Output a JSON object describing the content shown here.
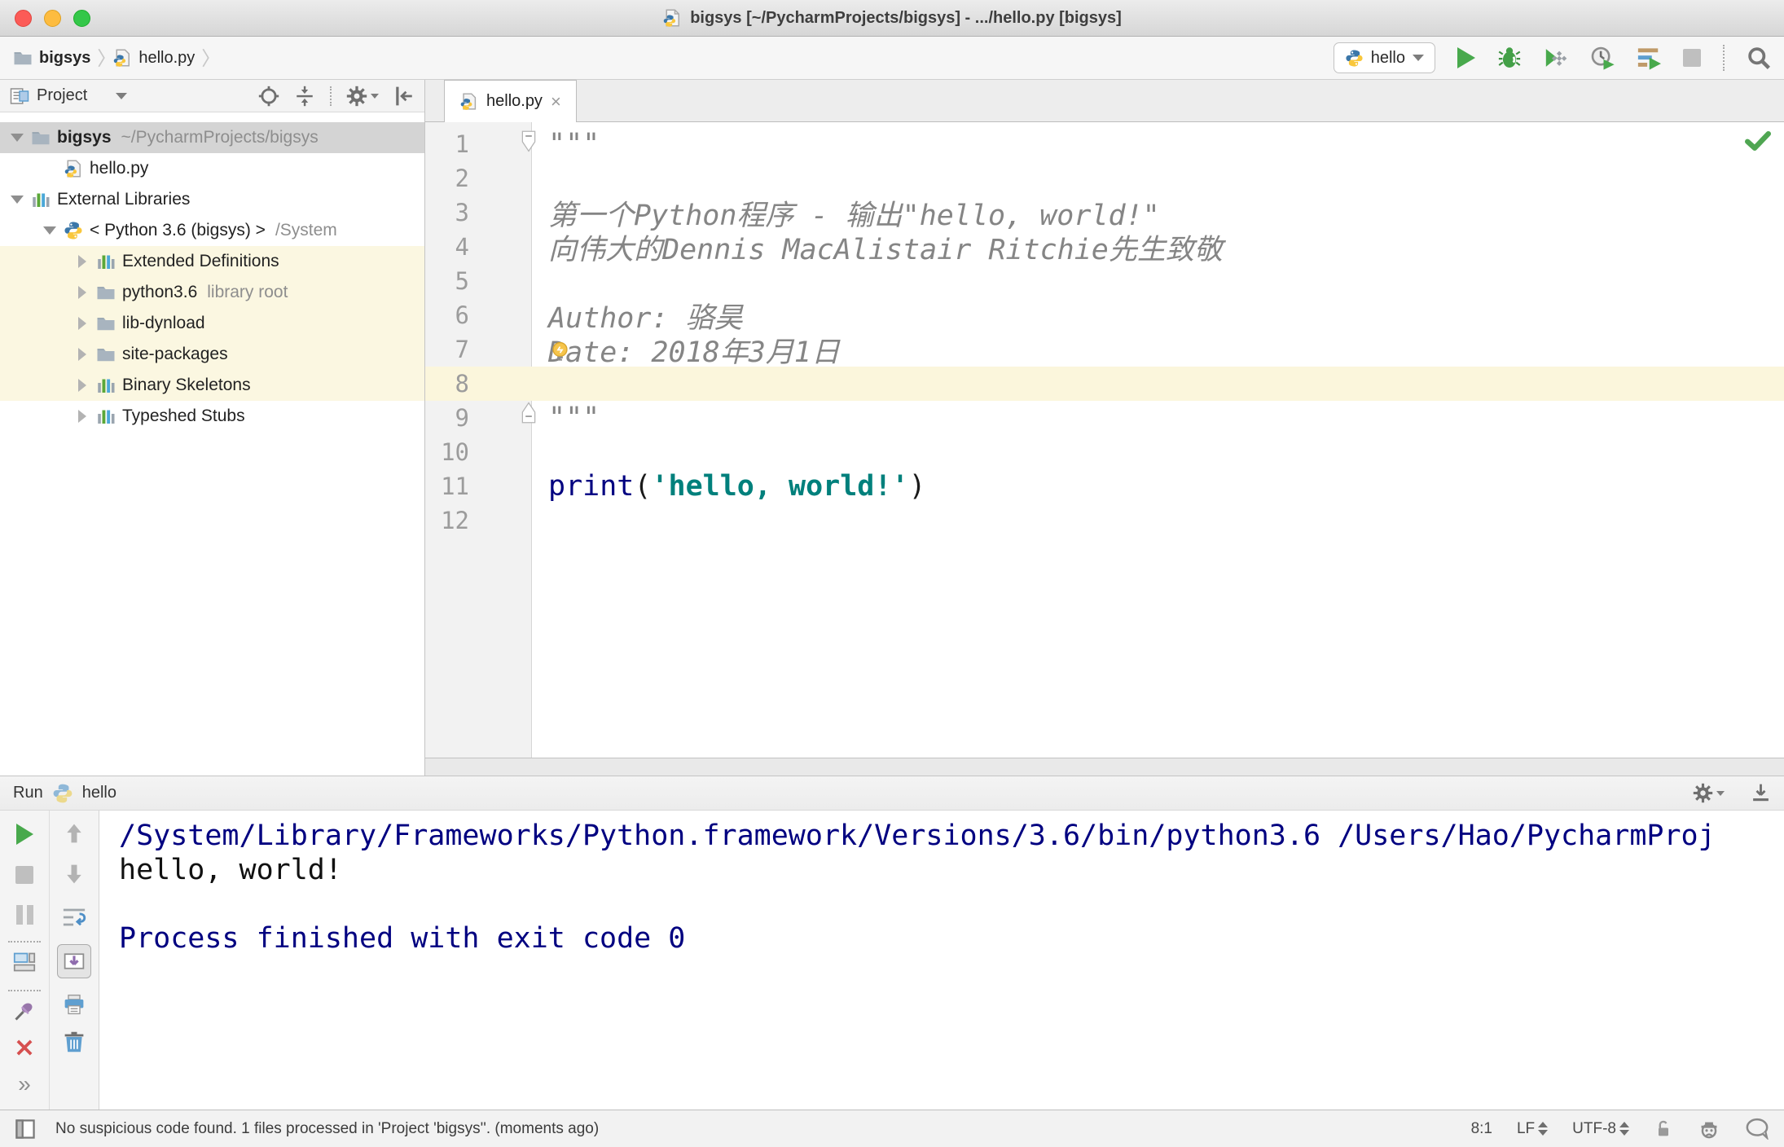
{
  "window": {
    "title": "bigsys [~/PycharmProjects/bigsys] - .../hello.py [bigsys]"
  },
  "navbar": {
    "breadcrumbs": [
      {
        "label": "bigsys"
      },
      {
        "label": "hello.py"
      }
    ],
    "run_config": "hello",
    "tools": {
      "run": "Run",
      "debug": "Debug",
      "coverage": "Run with Coverage",
      "profile": "Profile",
      "concurrency": "Concurrency Diagram",
      "stop": "Stop",
      "search": "Search Everywhere"
    }
  },
  "project": {
    "title": "Project",
    "tree": [
      {
        "label": "bigsys",
        "suffix": "~/PycharmProjects/bigsys"
      },
      {
        "label": "hello.py"
      },
      {
        "label": "External Libraries"
      },
      {
        "label": "< Python 3.6 (bigsys) >",
        "suffix": "/System"
      },
      {
        "label": "Extended Definitions"
      },
      {
        "label": "python3.6",
        "suffix": "library root"
      },
      {
        "label": "lib-dynload"
      },
      {
        "label": "site-packages"
      },
      {
        "label": "Binary Skeletons"
      },
      {
        "label": "Typeshed Stubs"
      }
    ]
  },
  "editor": {
    "tab": "hello.py",
    "lines": [
      {
        "num": "1",
        "text": "\"\"\""
      },
      {
        "num": "2",
        "text": ""
      },
      {
        "num": "3",
        "text": "第一个Python程序 - 输出\"hello, world!\""
      },
      {
        "num": "4",
        "text": "向伟大的Dennis MacAlistair Ritchie先生致敬"
      },
      {
        "num": "5",
        "text": ""
      },
      {
        "num": "6",
        "text": "Author: 骆昊"
      },
      {
        "num": "7",
        "text": "Date: 2018年3月1日"
      },
      {
        "num": "8",
        "text": ""
      },
      {
        "num": "9",
        "text": "\"\"\""
      },
      {
        "num": "10",
        "text": ""
      },
      {
        "num": "11",
        "kw": "print",
        "open": "(",
        "str": "'hello, world!'",
        "close": ")"
      },
      {
        "num": "12",
        "text": ""
      }
    ]
  },
  "run_panel": {
    "label": "Run",
    "config": "hello",
    "console": [
      "/System/Library/Frameworks/Python.framework/Versions/3.6/bin/python3.6 /Users/Hao/PycharmProj",
      "hello, world!",
      "",
      "Process finished with exit code 0"
    ]
  },
  "statusbar": {
    "message": "No suspicious code found. 1 files processed in 'Project 'bigsys''. (moments ago)",
    "caret": "8:1",
    "line_sep": "LF",
    "encoding": "UTF-8"
  },
  "icons": {
    "run": "green-play-triangle",
    "debug": "bug",
    "coverage": "checkered-play",
    "profile": "clock-play",
    "concurrency": "bars-play",
    "stop": "gray-square",
    "search": "magnifier",
    "settings": "gear",
    "locate": "crosshair",
    "collapse-all": "arrows-to-line",
    "hide-panel": "bar-left-arrow",
    "pin": "pin",
    "close": "red-x",
    "clear": "trash",
    "print": "printer",
    "scroll-to-end": "frame-down-arrow",
    "soft-wrap": "wrap-arrows",
    "lock": "open-padlock",
    "inspector": "hector-face",
    "event-log": "speech-bubble"
  },
  "colors": {
    "keyword": "#000080",
    "string": "#00807C",
    "docstring": "#8A8A8A",
    "console_system": "#000080",
    "current_line": "#FBF6DC",
    "tree_highlight": "#FBF7E1",
    "selection": "#D4D4D4",
    "run_green": "#48A94C"
  }
}
